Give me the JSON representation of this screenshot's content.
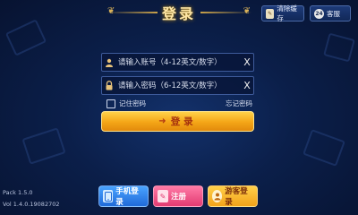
{
  "header": {
    "title": "登录",
    "clear_cache_label": "清除缓存",
    "service_label": "客服",
    "service_icon_text": "24"
  },
  "form": {
    "username_placeholder": "请输入账号（4-12英文/数字）",
    "password_placeholder": "请输入密码（6-12英文/数字）",
    "clear_symbol": "X",
    "remember_label": "记住密码",
    "forgot_label": "忘记密码",
    "login_label": "登录"
  },
  "bottom": {
    "phone_login_label": "手机登录",
    "register_label": "注册",
    "guest_login_label": "游客登录"
  },
  "version": {
    "pack": "Pack 1.5.0",
    "vol": "Vol 1.4.0.19082702"
  },
  "icons": {
    "user": "user-icon",
    "lock": "lock-icon",
    "phone": "phone-icon",
    "register": "edit-icon",
    "guest": "guest-icon"
  },
  "colors": {
    "accent": "#f4a516",
    "background": "#0b1f4a",
    "phone_button": "#1f6ad8",
    "register_button": "#e23b72",
    "guest_button": "#f2a31a"
  }
}
